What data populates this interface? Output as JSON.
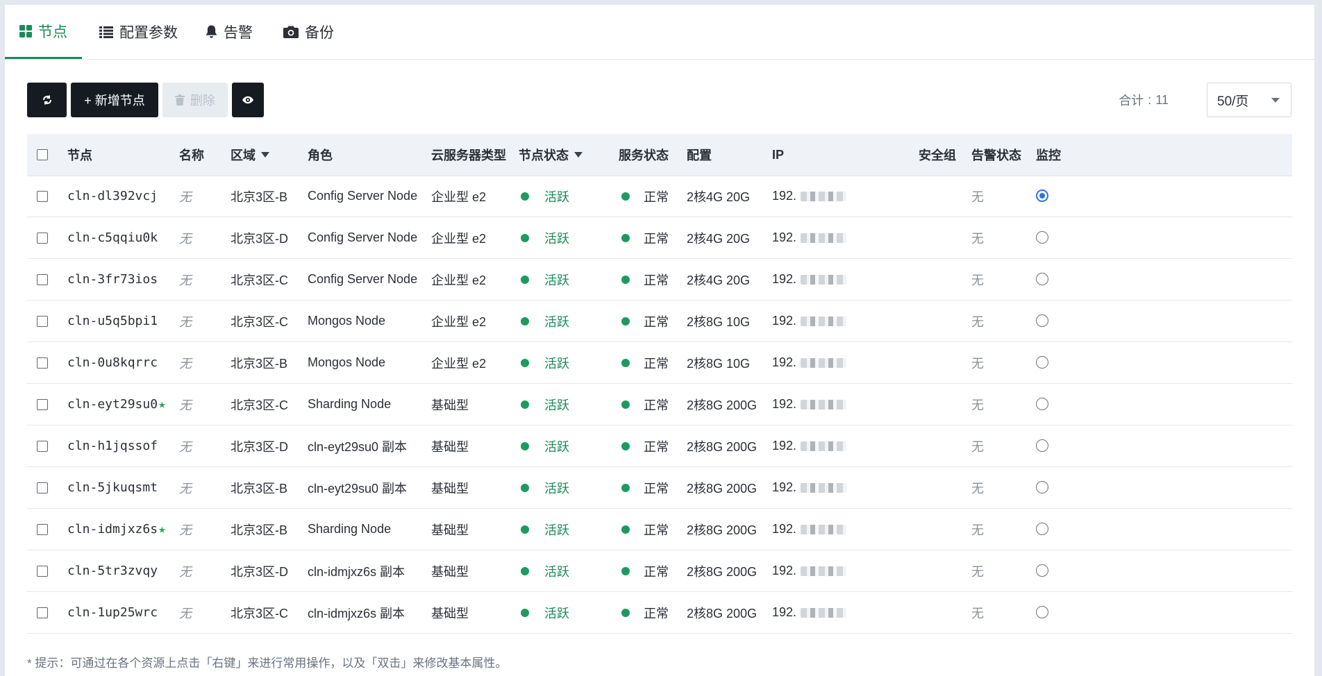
{
  "tabs": [
    {
      "label": "节点",
      "icon": "grid-icon",
      "active": true
    },
    {
      "label": "配置参数",
      "icon": "list-icon",
      "active": false
    },
    {
      "label": "告警",
      "icon": "bell-icon",
      "active": false
    },
    {
      "label": "备份",
      "icon": "camera-icon",
      "active": false
    }
  ],
  "toolbar": {
    "refresh_icon": "refresh-icon",
    "add_label": "+ 新增节点",
    "delete_label": "删除",
    "delete_icon": "trash-icon",
    "view_icon": "eye-icon",
    "total_label": "合计",
    "total_sep": ":",
    "total_value": "11",
    "page_size": "50/页"
  },
  "columns": {
    "node": "节点",
    "name": "名称",
    "zone": "区域",
    "role": "角色",
    "cloud_type": "云服务器类型",
    "node_status": "节点状态",
    "service_status": "服务状态",
    "config": "配置",
    "ip": "IP",
    "security_group": "安全组",
    "alarm_status": "告警状态",
    "monitor": "监控"
  },
  "rows": [
    {
      "node": "cln-dl392vcj",
      "star": false,
      "name": "无",
      "zone": "北京3区-B",
      "role": "Config Server Node",
      "cloud_type": "企业型 e2",
      "node_status": "活跃",
      "service_status": "正常",
      "config": "2核4G 20G",
      "ip": "192.",
      "alarm": "无",
      "monitor": true
    },
    {
      "node": "cln-c5qqiu0k",
      "star": false,
      "name": "无",
      "zone": "北京3区-D",
      "role": "Config Server Node",
      "cloud_type": "企业型 e2",
      "node_status": "活跃",
      "service_status": "正常",
      "config": "2核4G 20G",
      "ip": "192.",
      "alarm": "无",
      "monitor": false
    },
    {
      "node": "cln-3fr73ios",
      "star": false,
      "name": "无",
      "zone": "北京3区-C",
      "role": "Config Server Node",
      "cloud_type": "企业型 e2",
      "node_status": "活跃",
      "service_status": "正常",
      "config": "2核4G 20G",
      "ip": "192.",
      "alarm": "无",
      "monitor": false
    },
    {
      "node": "cln-u5q5bpi1",
      "star": false,
      "name": "无",
      "zone": "北京3区-C",
      "role": "Mongos Node",
      "cloud_type": "企业型 e2",
      "node_status": "活跃",
      "service_status": "正常",
      "config": "2核8G 10G",
      "ip": "192.",
      "alarm": "无",
      "monitor": false
    },
    {
      "node": "cln-0u8kqrrc",
      "star": false,
      "name": "无",
      "zone": "北京3区-B",
      "role": "Mongos Node",
      "cloud_type": "企业型 e2",
      "node_status": "活跃",
      "service_status": "正常",
      "config": "2核8G 10G",
      "ip": "192.",
      "alarm": "无",
      "monitor": false
    },
    {
      "node": "cln-eyt29su0",
      "star": true,
      "name": "无",
      "zone": "北京3区-C",
      "role": "Sharding Node",
      "cloud_type": "基础型",
      "node_status": "活跃",
      "service_status": "正常",
      "config": "2核8G 200G",
      "ip": "192.",
      "alarm": "无",
      "monitor": false
    },
    {
      "node": "cln-h1jqssof",
      "star": false,
      "name": "无",
      "zone": "北京3区-D",
      "role": "cln-eyt29su0 副本",
      "cloud_type": "基础型",
      "node_status": "活跃",
      "service_status": "正常",
      "config": "2核8G 200G",
      "ip": "192.",
      "alarm": "无",
      "monitor": false
    },
    {
      "node": "cln-5jkuqsmt",
      "star": false,
      "name": "无",
      "zone": "北京3区-B",
      "role": "cln-eyt29su0 副本",
      "cloud_type": "基础型",
      "node_status": "活跃",
      "service_status": "正常",
      "config": "2核8G 200G",
      "ip": "192.",
      "alarm": "无",
      "monitor": false
    },
    {
      "node": "cln-idmjxz6s",
      "star": true,
      "name": "无",
      "zone": "北京3区-B",
      "role": "Sharding Node",
      "cloud_type": "基础型",
      "node_status": "活跃",
      "service_status": "正常",
      "config": "2核8G 200G",
      "ip": "192.",
      "alarm": "无",
      "monitor": false
    },
    {
      "node": "cln-5tr3zvqy",
      "star": false,
      "name": "无",
      "zone": "北京3区-D",
      "role": "cln-idmjxz6s 副本",
      "cloud_type": "基础型",
      "node_status": "活跃",
      "service_status": "正常",
      "config": "2核8G 200G",
      "ip": "192.",
      "alarm": "无",
      "monitor": false
    },
    {
      "node": "cln-1up25wrc",
      "star": false,
      "name": "无",
      "zone": "北京3区-C",
      "role": "cln-idmjxz6s 副本",
      "cloud_type": "基础型",
      "node_status": "活跃",
      "service_status": "正常",
      "config": "2核8G 200G",
      "ip": "192.",
      "alarm": "无",
      "monitor": false
    }
  ],
  "star_glyph": "★",
  "colors": {
    "accent": "#1a8a5a",
    "status_dot": "#1e9a5f",
    "dark_button": "#161b22",
    "radio_selected": "#2d6fe6"
  },
  "footer_note": "* 提示：可通过在各个资源上点击「右键」来进行常用操作，以及「双击」来修改基本属性。"
}
